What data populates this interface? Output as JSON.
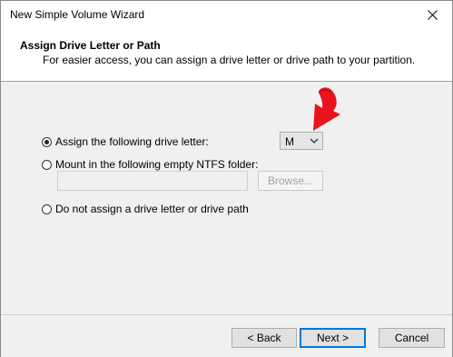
{
  "window": {
    "title": "New Simple Volume Wizard",
    "close_icon": "close-icon"
  },
  "header": {
    "title": "Assign Drive Letter or Path",
    "subtitle": "For easier access, you can assign a drive letter or drive path to your partition."
  },
  "options": {
    "assign_letter": {
      "label": "Assign the following drive letter:",
      "checked": true
    },
    "mount_folder": {
      "label": "Mount in the following empty NTFS folder:",
      "checked": false
    },
    "no_assign": {
      "label": "Do not assign a drive letter or drive path",
      "checked": false
    }
  },
  "drive_letter": {
    "value": "M"
  },
  "folder_path": {
    "value": ""
  },
  "browse_label": "Browse...",
  "footer": {
    "back_label": "< Back",
    "next_label": "Next >",
    "cancel_label": "Cancel"
  },
  "colors": {
    "accent": "#0078d7",
    "arrow": "#e8141c"
  }
}
